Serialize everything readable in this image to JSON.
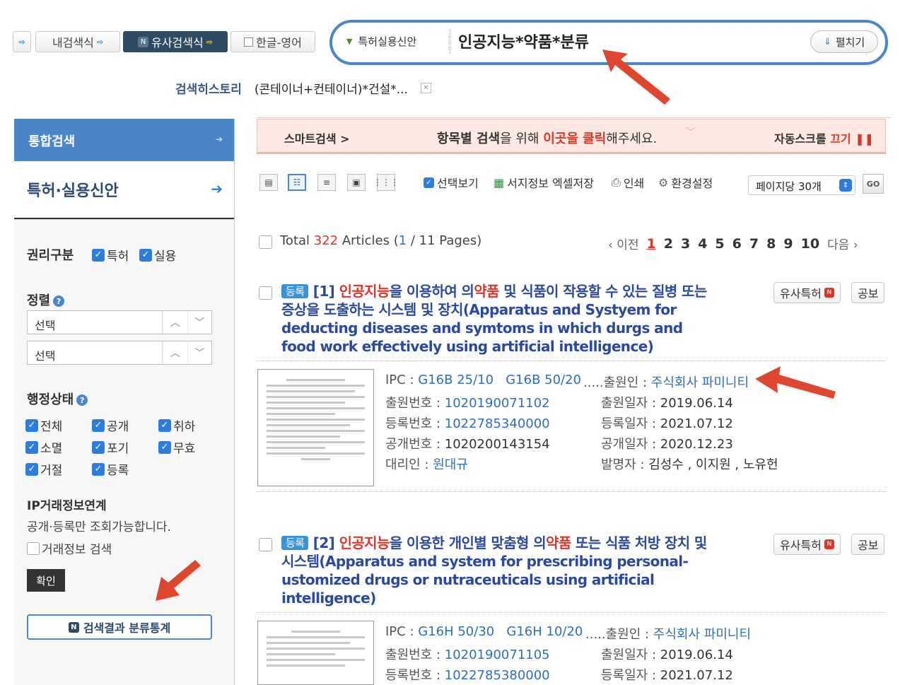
{
  "toolbar": {
    "icon_only_label": "",
    "my_search": "내검색식",
    "similar_search": "유사검색식",
    "han_eng": "한글-영어"
  },
  "search": {
    "scope": "특허실용신안",
    "query": "인공지능*약품*분류",
    "expand": "펼치기"
  },
  "history": {
    "label": "검색히스토리",
    "item": "(콘테이너+컨테이너)*건설*..."
  },
  "sidebar": {
    "tab_all": "통합검색",
    "tab_patent": "특허·실용신안",
    "rights_label": "권리구분",
    "rights": [
      "특허",
      "실용"
    ],
    "sort_label": "정렬",
    "sort1": "선택",
    "sort2": "선택",
    "status_label": "행정상태",
    "status": [
      "전체",
      "공개",
      "취하",
      "소멸",
      "포기",
      "무효",
      "거절",
      "등록"
    ],
    "ip_label": "IP거래정보연계",
    "ip_note": "공개·등록만 조회가능합니다.",
    "ip_check": "거래정보 검색",
    "ok": "확인",
    "stats": "검색결과 분류통계"
  },
  "smartbar": {
    "smart": "스마트검색 >",
    "msg_a": "항목별 검색",
    "msg_b": "을 위해 ",
    "msg_c": "이곳을 클릭",
    "msg_d": "해주세요.",
    "auto_a": "자동스크롤 ",
    "auto_b": "끄기"
  },
  "viewbar": {
    "select_view": "선택보기",
    "excel": "서지정보 엑셀저장",
    "print": "인쇄",
    "settings": "환경설정",
    "per_page": "페이지당 30개",
    "go": "GO"
  },
  "results_summary": {
    "total_prefix": "Total ",
    "total": "322",
    "articles": " Articles (",
    "page": "1",
    "pages_suffix": " / 11 Pages)",
    "prev": "‹ 이전",
    "next": "다음 ›",
    "pages": [
      "1",
      "2",
      "3",
      "4",
      "5",
      "6",
      "7",
      "8",
      "9",
      "10"
    ]
  },
  "results": [
    {
      "badge": "등록",
      "num": "[1]",
      "t1": "인공지능",
      "t2": "을 이용하여 의",
      "t3": "약품",
      "t4": " 및 식품이 작용할 수 있는 질병 또는 증상을 도출하는 시스템 및 장치(Apparatus and Systyem for deducting diseases and symtoms in which durgs and food work effectively using artificial intelligence)",
      "similar": "유사특허",
      "gazette": "공보",
      "ipc_k": "IPC : ",
      "ipc": "G16B 25/10   G16B 50/20",
      "applicant_k": ".....출원인 : ",
      "applicant": "주식회사 파미니티",
      "app_no_k": "출원번호 : ",
      "app_no": "1020190071102",
      "app_date_k": "출원일자 : ",
      "app_date": "2019.06.14",
      "reg_no_k": "등록번호 : ",
      "reg_no": "1022785340000",
      "reg_date_k": "등록일자 : ",
      "reg_date": "2021.07.12",
      "pub_no_k": "공개번호 : ",
      "pub_no": "1020200143154",
      "pub_date_k": "공개일자 : ",
      "pub_date": "2020.12.23",
      "agent_k": "대리인 : ",
      "agent": "원대규",
      "inventor_k": "발명자 : ",
      "inventor": "김성수 , 이지원 , 노유헌"
    },
    {
      "badge": "등록",
      "num": "[2]",
      "t1": "인공지능",
      "t2": "을 이용한 개인별 맞춤형 의",
      "t3": "약품",
      "t4": " 또는 식품 처방 장치 및 시스템(Apparatus and system for prescribing personal-ustomized drugs or nutraceuticals using artificial intelligence)",
      "similar": "유사특허",
      "gazette": "공보",
      "ipc_k": "IPC : ",
      "ipc": "G16H 50/30   G16H 10/20",
      "applicant_k": ".....출원인 : ",
      "applicant": "주식회사 파미니티",
      "app_no_k": "출원번호 : ",
      "app_no": "1020190071105",
      "app_date_k": "출원일자 : ",
      "app_date": "2019.06.14",
      "reg_no_k": "등록번호 : ",
      "reg_no": "1022785380000",
      "reg_date_k": "등록일자 : ",
      "reg_date": "2021.07.12"
    }
  ],
  "colors": {
    "accent": "#4a86c8",
    "highlight": "#d9372c",
    "annotation_arrow": "#e0452e"
  }
}
